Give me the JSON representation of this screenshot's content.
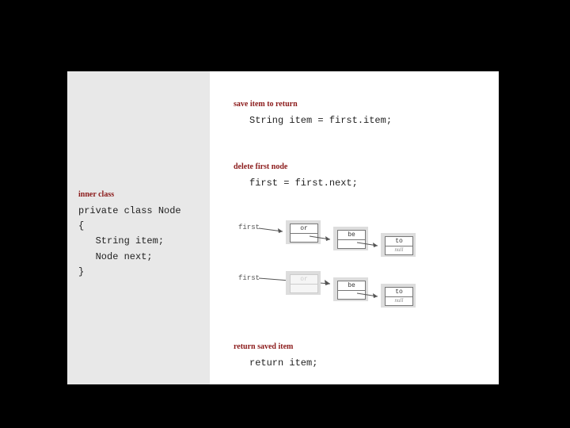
{
  "left": {
    "title": "inner class",
    "code": "private class Node\n{\n   String item;\n   Node next;\n}"
  },
  "right": {
    "sec1": {
      "title": "save item to return",
      "code": "String item = first.item;"
    },
    "sec2": {
      "title": "delete first node",
      "code": "first = first.next;"
    },
    "sec3": {
      "title": "return saved item",
      "code": "return item;"
    },
    "dia": {
      "label": "first",
      "nodes": {
        "n1": "or",
        "n2": "be",
        "n3": "to",
        "null": "null"
      }
    }
  }
}
